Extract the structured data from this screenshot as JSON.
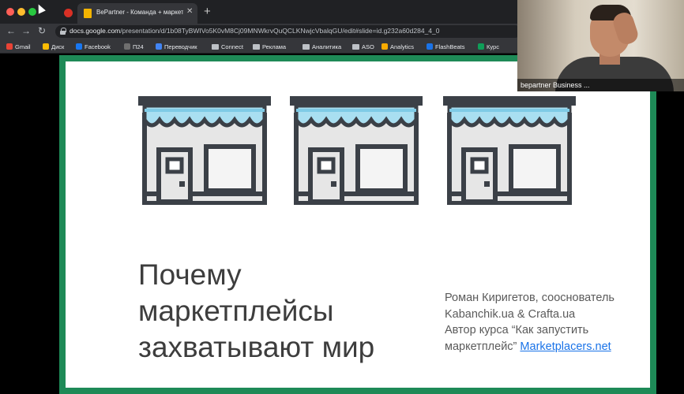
{
  "browser": {
    "tab": {
      "title": "BePartner - Команда + маркетп...",
      "close": "✕"
    },
    "new_tab": "+",
    "nav": {
      "back": "←",
      "forward": "→",
      "reload": "↻"
    },
    "url_host": "docs.google.com",
    "url_path": "/presentation/d/1b08TyBWIVo5K0vM8Cj09MNWkrvQuQCLKNwjcVbalqGU/edit#slide=id.g232a60d284_4_0"
  },
  "bookmarks": [
    {
      "label": "Gmail",
      "icon": "gmail-icon",
      "color": "#ea4335"
    },
    {
      "label": "Диск",
      "icon": "drive-icon",
      "color": "#fbbc04"
    },
    {
      "label": "Facebook",
      "icon": "facebook-icon",
      "color": "#1877f2"
    },
    {
      "label": "П24",
      "icon": "p24-icon",
      "color": "#6f6f6f"
    },
    {
      "label": "Переводчик",
      "icon": "translate-icon",
      "color": "#4285f4"
    },
    {
      "label": "Connect",
      "icon": "folder-icon",
      "color": "#bdc1c6"
    },
    {
      "label": "Реклама",
      "icon": "folder-icon",
      "color": "#bdc1c6"
    },
    {
      "label": "Аналитика",
      "icon": "folder-icon",
      "color": "#bdc1c6"
    },
    {
      "label": "ASO",
      "icon": "folder-icon",
      "color": "#bdc1c6"
    },
    {
      "label": "Analytics",
      "icon": "analytics-icon",
      "color": "#f9ab00"
    },
    {
      "label": "FlashBeats",
      "icon": "flashbeats-icon",
      "color": "#1a73e8"
    },
    {
      "label": "Курс",
      "icon": "course-icon",
      "color": "#0f9d58"
    }
  ],
  "slide": {
    "title_lines": [
      "Почему",
      "маркетплейсы",
      "захватывают мир"
    ],
    "author_lines": [
      "Роман Киригетов, сооснователь",
      "Kabanchik.ua & Crafta.ua",
      "Автор курса “Как запустить"
    ],
    "author_last_prefix": "маркетплейс” ",
    "author_link": "Marketplacers.net"
  },
  "webcam": {
    "name": "bepartner Business ..."
  }
}
